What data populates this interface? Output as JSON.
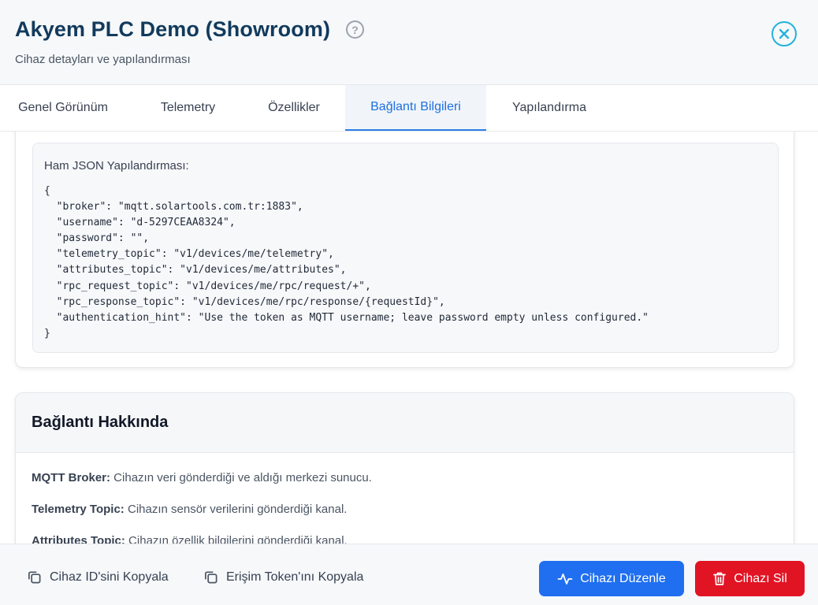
{
  "header": {
    "title": "Akyem PLC Demo (Showroom)",
    "subtitle": "Cihaz detayları ve yapılandırması",
    "help_glyph": "?"
  },
  "tabs": [
    {
      "label": "Genel Görünüm",
      "active": false
    },
    {
      "label": "Telemetry",
      "active": false
    },
    {
      "label": "Özellikler",
      "active": false
    },
    {
      "label": "Bağlantı Bilgileri",
      "active": true
    },
    {
      "label": "Yapılandırma",
      "active": false
    }
  ],
  "json_config": {
    "label": "Ham JSON Yapılandırması:",
    "code": "{\n  \"broker\": \"mqtt.solartools.com.tr:1883\",\n  \"username\": \"d-5297CEAA8324\",\n  \"password\": \"\",\n  \"telemetry_topic\": \"v1/devices/me/telemetry\",\n  \"attributes_topic\": \"v1/devices/me/attributes\",\n  \"rpc_request_topic\": \"v1/devices/me/rpc/request/+\",\n  \"rpc_response_topic\": \"v1/devices/me/rpc/response/{requestId}\",\n  \"authentication_hint\": \"Use the token as MQTT username; leave password empty unless configured.\"\n}"
  },
  "about": {
    "title": "Bağlantı Hakkında",
    "items": [
      {
        "term": "MQTT Broker:",
        "desc": " Cihazın veri gönderdiği ve aldığı merkezi sunucu."
      },
      {
        "term": "Telemetry Topic:",
        "desc": " Cihazın sensör verilerini gönderdiği kanal."
      },
      {
        "term": "Attributes Topic:",
        "desc": " Cihazın özellik bilgilerini gönderdiği kanal."
      }
    ]
  },
  "footer": {
    "copy_id_label": "Cihaz ID'sini Kopyala",
    "copy_token_label": "Erişim Token'ını Kopyala",
    "edit_label": "Cihazı Düzenle",
    "delete_label": "Cihazı Sil"
  },
  "colors": {
    "title": "#123a5c",
    "accent": "#1f6ff0",
    "danger": "#e11424",
    "close": "#22b3dc"
  }
}
